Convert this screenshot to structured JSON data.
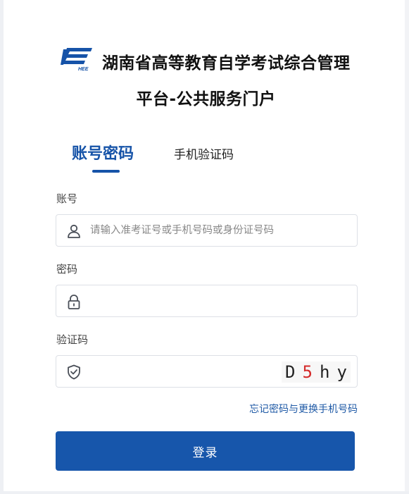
{
  "header": {
    "title_line1": "湖南省高等教育自学考试综合管理",
    "title_line2": "平台-公共服务门户",
    "logo_icon": "hnee-logo-icon"
  },
  "tabs": {
    "account_label": "账号密码",
    "phone_label": "手机验证码",
    "active": "account"
  },
  "form": {
    "account_label": "账号",
    "account_placeholder": "请输入准考证号或手机号码或身份证号码",
    "account_value": "",
    "password_label": "密码",
    "password_value": "",
    "captcha_label": "验证码",
    "captcha_value": "",
    "captcha_chars": [
      "D",
      "5",
      "h",
      "y"
    ],
    "captcha_colors": [
      "#222222",
      "#d42a2a",
      "#222222",
      "#222222"
    ],
    "forgot_link": "忘记密码与更换手机号码",
    "login_button": "登录"
  },
  "icons": {
    "user": "user-icon",
    "lock": "lock-icon",
    "shield": "shield-check-icon"
  },
  "colors": {
    "accent": "#1653a8",
    "button": "#1756ab",
    "link": "#1f5aa6"
  }
}
